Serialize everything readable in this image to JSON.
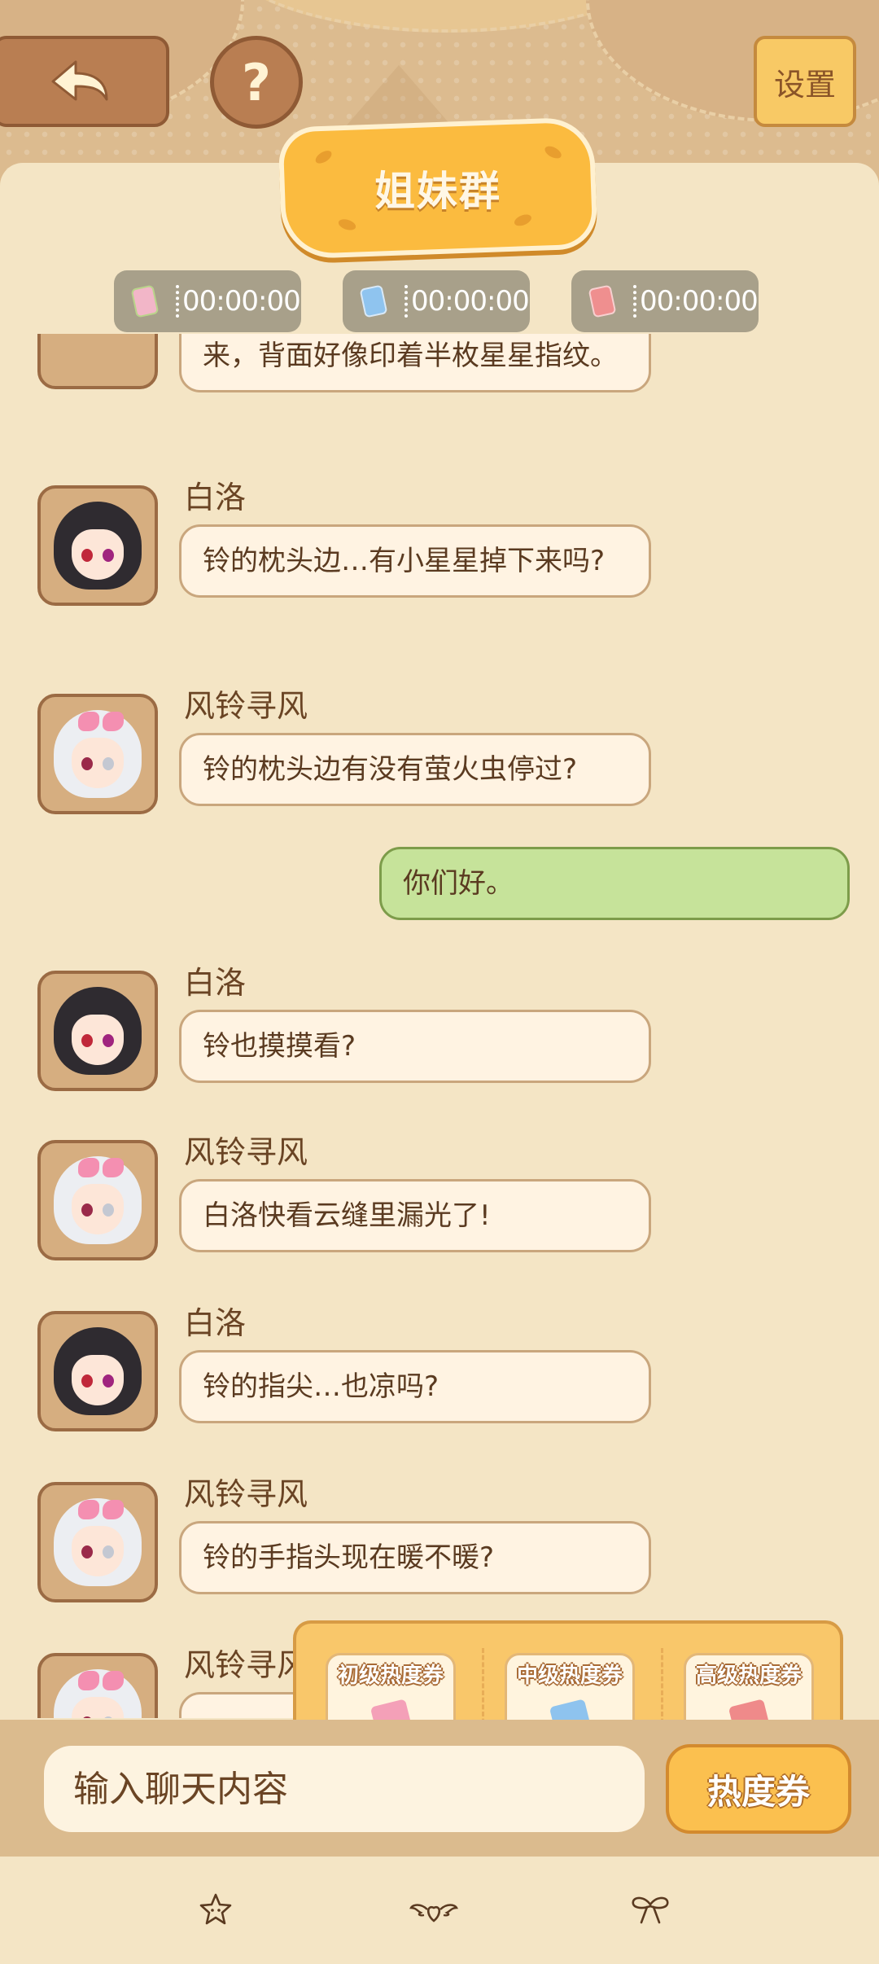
{
  "header": {
    "back_icon": "back-arrow-icon",
    "help_label": "?",
    "settings_label": "设置"
  },
  "chat": {
    "title": "姐妹群",
    "timers": [
      {
        "time": "00:00:00",
        "icon": "green-coupon-icon",
        "color": "#f2b6c8"
      },
      {
        "time": "00:00:00",
        "icon": "blue-coupon-icon",
        "color": "#8fc4ef"
      },
      {
        "time": "00:00:00",
        "icon": "red-coupon-icon",
        "color": "#ef8f8f"
      }
    ]
  },
  "messages": [
    {
      "sender": "",
      "text": "来，背面好像印着半枚星星指纹。"
    },
    {
      "sender": "白洛",
      "text": "铃的枕头边…有小星星掉下来吗?"
    },
    {
      "sender": "风铃寻风",
      "text": "铃的枕头边有没有萤火虫停过?"
    },
    {
      "sender": "self",
      "text": "你们好。"
    },
    {
      "sender": "白洛",
      "text": "铃也摸摸看?"
    },
    {
      "sender": "风铃寻风",
      "text": "白洛快看云缝里漏光了!"
    },
    {
      "sender": "白洛",
      "text": "铃的指尖…也凉吗?"
    },
    {
      "sender": "风铃寻风",
      "text": "铃的手指头现在暖不暖?"
    },
    {
      "sender": "风铃寻风",
      "text": ""
    }
  ],
  "coupons": [
    {
      "label": "初级热度券",
      "color": "#f4a0b8"
    },
    {
      "label": "中级热度券",
      "color": "#8ec3ee"
    },
    {
      "label": "高级热度券",
      "color": "#ef8a8a"
    }
  ],
  "input": {
    "placeholder": "输入聊天内容",
    "coupon_button_label": "热度券"
  },
  "bottom_nav": [
    {
      "icon": "star-face-icon"
    },
    {
      "icon": "winged-heart-icon"
    },
    {
      "icon": "bow-icon"
    }
  ],
  "colors": {
    "background": "#f4e5c5",
    "header": "#dcbb8f",
    "accent": "#fbbb3f",
    "self_bubble": "#c6e39a"
  }
}
